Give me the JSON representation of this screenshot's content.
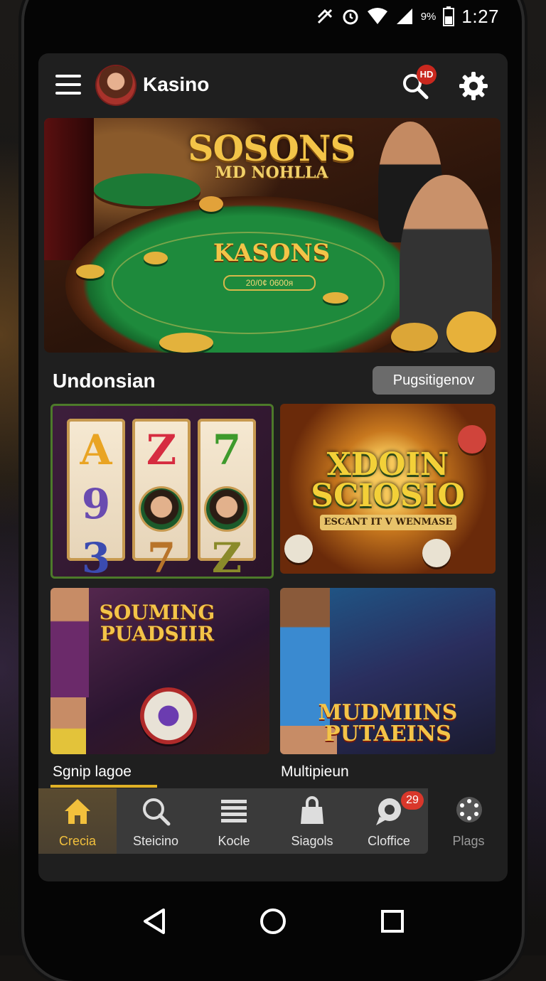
{
  "status": {
    "battery_percent": "9%",
    "time": "1:27"
  },
  "appbar": {
    "title": "Kasino",
    "search_badge": "HD"
  },
  "hero": {
    "title": "SOSONS",
    "subtitle": "MD NOHLLA",
    "center_text": "KASONS",
    "plate_text": "20/0¢ 0600ᴙ"
  },
  "section": {
    "title": "Undonsian",
    "button_label": "Pugsitigenov"
  },
  "tiles": [
    {
      "name": "slots",
      "symbols": [
        "A",
        "Z",
        "7",
        "9",
        "3",
        "7",
        "Z"
      ]
    },
    {
      "name": "xdoin",
      "title_line1": "XDOIN",
      "title_line2": "SCIOSIO",
      "banner": "ESCANT IT V WENMASE"
    },
    {
      "name": "souming",
      "title_line1": "SOUMING",
      "title_line2": "PUADSIIR",
      "caption": "Sgnip lagoe"
    },
    {
      "name": "mudmiins",
      "title_line1": "MUDMIINS",
      "title_line2": "PUTAEINS",
      "caption": "Multipieun"
    }
  ],
  "nav": {
    "items": [
      {
        "label": "Crecia",
        "icon": "home-icon"
      },
      {
        "label": "Steicino",
        "icon": "search-icon"
      },
      {
        "label": "Kocle",
        "icon": "list-icon"
      },
      {
        "label": "Siagols",
        "icon": "bag-icon"
      },
      {
        "label": "Cloffice",
        "icon": "chat-icon",
        "badge": "29"
      }
    ],
    "extra": {
      "label": "Plags",
      "icon": "dots-circle-icon"
    }
  },
  "colors": {
    "accent": "#f2c03c",
    "badge": "#d9372b",
    "felt": "#1e8a3c"
  }
}
